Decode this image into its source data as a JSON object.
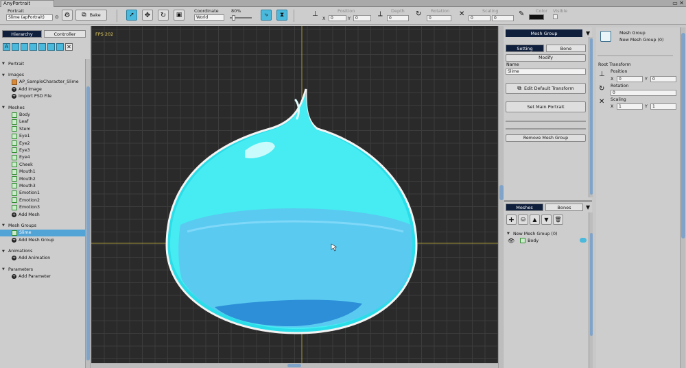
{
  "window": {
    "tab_title": "AnyPortrait",
    "controls": "▭ ✕"
  },
  "toolbar": {
    "portrait_label": "Portrait",
    "portrait_value": "Slime (apPortrait)",
    "bake_label": "Bake",
    "coordinate_label": "Coordinate",
    "coordinate_value": "World",
    "zoom_value": "80%",
    "position_label": "Position",
    "depth_label": "Depth",
    "rotation_label": "Rotation",
    "scaling_label": "Scaling",
    "color_label": "Color",
    "visible_label": "Visible",
    "x_label": "X",
    "y_label": "Y",
    "pos_x": "0",
    "pos_y": "0",
    "depth": "0",
    "rotation": "0",
    "scale_x": "0",
    "scale_y": "0"
  },
  "left_panel": {
    "tab_hierarchy": "Hierarchy",
    "tab_controller": "Controller",
    "portrait_section": "Portrait",
    "images_section": "Images",
    "images": [
      "AP_SampleCharacter_Slime"
    ],
    "add_image": "Add Image",
    "import_psd": "Import PSD File",
    "meshes_section": "Meshes",
    "meshes": [
      "Body",
      "Leaf",
      "Stem",
      "Eye1",
      "Eye2",
      "Eye3",
      "Eye4",
      "Cheek",
      "Mouth1",
      "Mouth2",
      "Mouth3",
      "Emotion1",
      "Emotion2",
      "Emotion3"
    ],
    "add_mesh": "Add Mesh",
    "mesh_groups_section": "Mesh Groups",
    "mesh_groups": [
      "Slime"
    ],
    "add_mesh_group": "Add Mesh Group",
    "animations_section": "Animations",
    "add_animation": "Add Animation",
    "parameters_section": "Parameters",
    "add_parameter": "Add Parameter"
  },
  "canvas": {
    "fps": "FPS 202",
    "grid_color": "#3c3c3c",
    "bg_color": "#2a2a2a",
    "axis_color": "#c8b43c"
  },
  "mesh_group_panel": {
    "title": "Mesh Group",
    "tab_setting": "Setting",
    "tab_bone": "Bone",
    "modify": "Modify",
    "name_label": "Name",
    "name_value": "Slime",
    "edit_default_transform": "Edit Default Transform",
    "set_main_portrait": "Set Main Portrait",
    "remove_mesh_group": "Remove Mesh Group"
  },
  "meshes_panel": {
    "tab_meshes": "Meshes",
    "tab_bones": "Bones",
    "group_label": "New Mesh Group (0)",
    "child_label": "Body"
  },
  "inspector": {
    "header_title": "Mesh Group",
    "header_sub": "New Mesh Group (0)",
    "root_transform": "Root Transform",
    "position_label": "Position",
    "pos_x": "0",
    "pos_y": "0",
    "rotation_label": "Rotation",
    "rotation": "0",
    "scaling_label": "Scaling",
    "scale_x": "1",
    "scale_y": "1",
    "x_label": "X",
    "y_label": "Y"
  },
  "colors": {
    "accent": "#4ab9dc",
    "dark_tab": "#0f1f3c",
    "selected_row": "#53a4d6"
  }
}
